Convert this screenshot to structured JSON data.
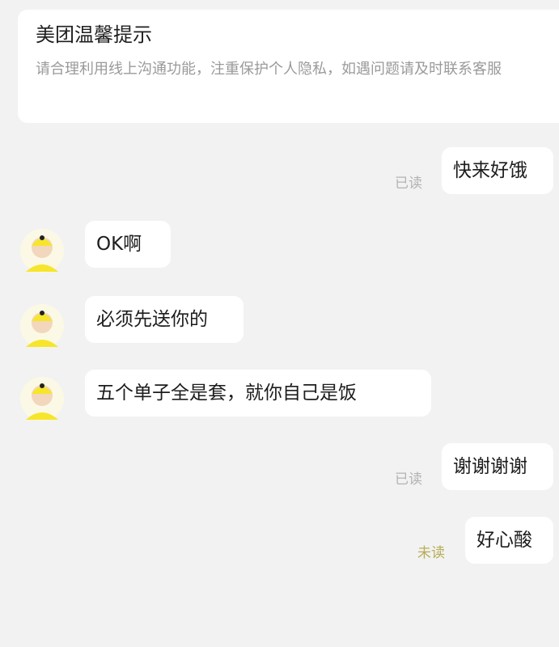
{
  "notice": {
    "title": "美团温馨提示",
    "body": "请合理利用线上沟通功能，注重保护个人隐私，如遇问题请及时联系客服"
  },
  "messages": [
    {
      "direction": "out",
      "text": "快来好饿",
      "status": "已读"
    },
    {
      "direction": "in",
      "text": "OK啊"
    },
    {
      "direction": "in",
      "text": "必须先送你的"
    },
    {
      "direction": "in",
      "text": "五个单子全是套，就你自己是饭"
    },
    {
      "direction": "out",
      "text": "谢谢谢谢",
      "status": "已读"
    },
    {
      "direction": "out",
      "text": "好心酸",
      "status": "未读"
    }
  ],
  "colors": {
    "background": "#f2f2f2",
    "bubble": "#ffffff",
    "read_status": "#b3b3b3",
    "unread_status": "#b7ad57",
    "avatar_yellow": "#f7e52b"
  },
  "icons": {
    "avatar": "rider-avatar-icon"
  }
}
